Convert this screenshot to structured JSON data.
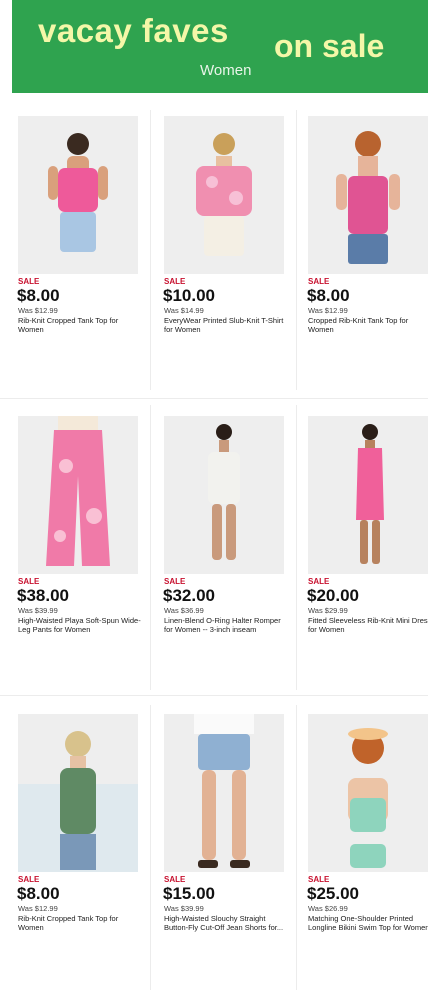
{
  "banner": {
    "title_left": "vacay faves",
    "title_right": "on sale",
    "subtitle": "Women",
    "bg_color": "#2fa34f",
    "text_color": "#f4f7a8"
  },
  "products": [
    {
      "sale": "SALE",
      "price": "$8.00",
      "was": "Was $12.99",
      "name": "Rib-Knit Cropped Tank Top for Women",
      "colors": {
        "top": "#ee5a9a",
        "bottom": "#a9c6e3",
        "skin": "#d9a07c",
        "hair": "#3a2a20"
      }
    },
    {
      "sale": "SALE",
      "price": "$10.00",
      "was": "Was $14.99",
      "name": "EveryWear Printed Slub-Knit T-Shirt for Women",
      "colors": {
        "top": "#f08fb0",
        "bottom": "#f4efe4",
        "skin": "#e8c0a0",
        "hair": "#c9a05a"
      }
    },
    {
      "sale": "SALE",
      "price": "$8.00",
      "was": "Was $12.99",
      "name": "Cropped Rib-Knit Tank Top for Women",
      "colors": {
        "top": "#e05493",
        "bottom": "#5a7ca8",
        "skin": "#e6b49a",
        "hair": "#b8632f"
      }
    },
    {
      "sale": "SALE",
      "price": "$38.00",
      "was": "Was $39.99",
      "name": "High-Waisted Playa Soft-Spun Wide-Leg Pants for Women",
      "colors": {
        "top": "#f4e9d9",
        "bottom": "#f07aa8",
        "skin": "#e0b090",
        "hair": "#3a2a20"
      }
    },
    {
      "sale": "SALE",
      "price": "$32.00",
      "was": "Was $36.99",
      "name": "Linen-Blend O-Ring Halter Romper for Women -- 3-inch inseam",
      "colors": {
        "top": "#f2f2ee",
        "bottom": "#f2f2ee",
        "skin": "#c99a7c",
        "hair": "#2a1e18"
      }
    },
    {
      "sale": "SALE",
      "price": "$20.00",
      "was": "Was $29.99",
      "name": "Fitted Sleeveless Rib-Knit Mini Dress for Women",
      "colors": {
        "top": "#f0609a",
        "bottom": "#f0609a",
        "skin": "#b7825e",
        "hair": "#2a1e18"
      }
    },
    {
      "sale": "SALE",
      "price": "$8.00",
      "was": "Was $12.99",
      "name": "Rib-Knit Cropped Tank Top for Women",
      "colors": {
        "top": "#5f8a64",
        "bottom": "#7a98b8",
        "skin": "#e6c2a4",
        "hair": "#d8c28c"
      }
    },
    {
      "sale": "SALE",
      "price": "$15.00",
      "was": "Was $39.99",
      "name": "High-Waisted Slouchy Straight Button-Fly Cut-Off Jean Shorts for...",
      "colors": {
        "top": "#fafafa",
        "bottom": "#8fb0d2",
        "skin": "#e2b294",
        "hair": "#3a2a20"
      }
    },
    {
      "sale": "SALE",
      "price": "$25.00",
      "was": "Was $26.99",
      "name": "Matching One-Shoulder Printed Longline Bikini Swim Top for Women",
      "colors": {
        "top": "#8ed4bd",
        "bottom": "#8ed4bd",
        "skin": "#ecc4a6",
        "hair": "#c0632a"
      }
    }
  ]
}
